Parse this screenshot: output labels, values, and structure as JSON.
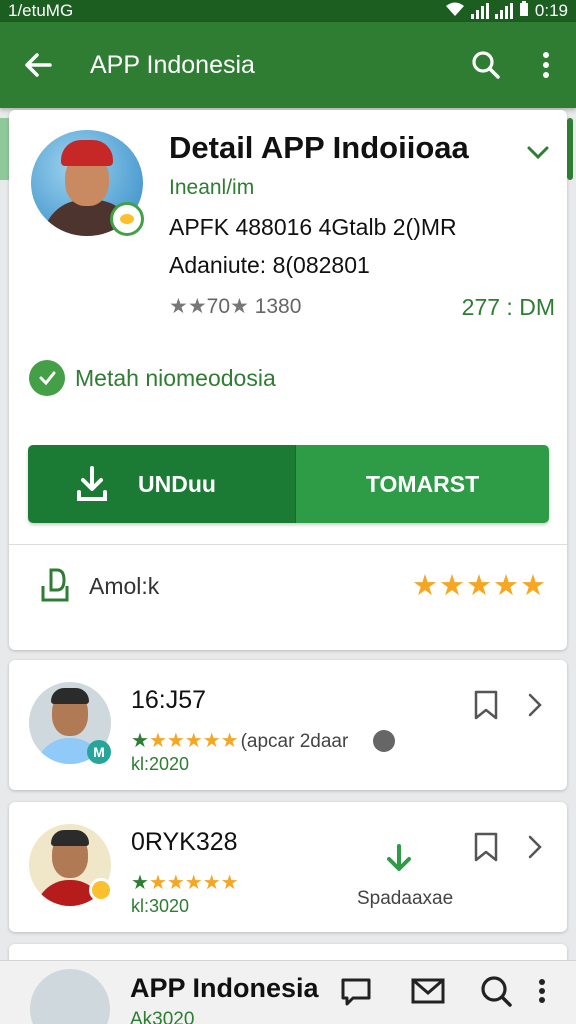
{
  "status_bar": {
    "left_text": "1/etuMG",
    "time": "0:19"
  },
  "app_bar": {
    "title": "APP Indonesia"
  },
  "detail": {
    "title": "Detail APP Indoiioaa",
    "subtitle": "Ineanl/im",
    "line1": "APFK 488016 4Gtalb 2()MR",
    "line2": "Adaniute: 8(082801",
    "rating_text": "70",
    "rating_count": "1380",
    "size": "277 : DM",
    "verified_text": "Metah niomeodosia",
    "download_label": "UNDuu",
    "secondary_label": "TOMARST",
    "bottom_label": "Amol:k",
    "bottom_stars": "★★★★★"
  },
  "list": [
    {
      "title": "16:J57",
      "stars": "★★★★★",
      "extra": "(apcar 2daar",
      "date": "kl:2020",
      "badge": "M"
    },
    {
      "title": "0RYK328",
      "stars": "★★★★★",
      "date": "kl:3020",
      "download_label": "Spadaaxae"
    }
  ],
  "bottom_bar": {
    "title": "APP Indonesia",
    "subtitle": "Ak3020"
  },
  "colors": {
    "primary": "#2e7d32",
    "primary_dark": "#1b5e20",
    "accent": "#f5a623"
  }
}
